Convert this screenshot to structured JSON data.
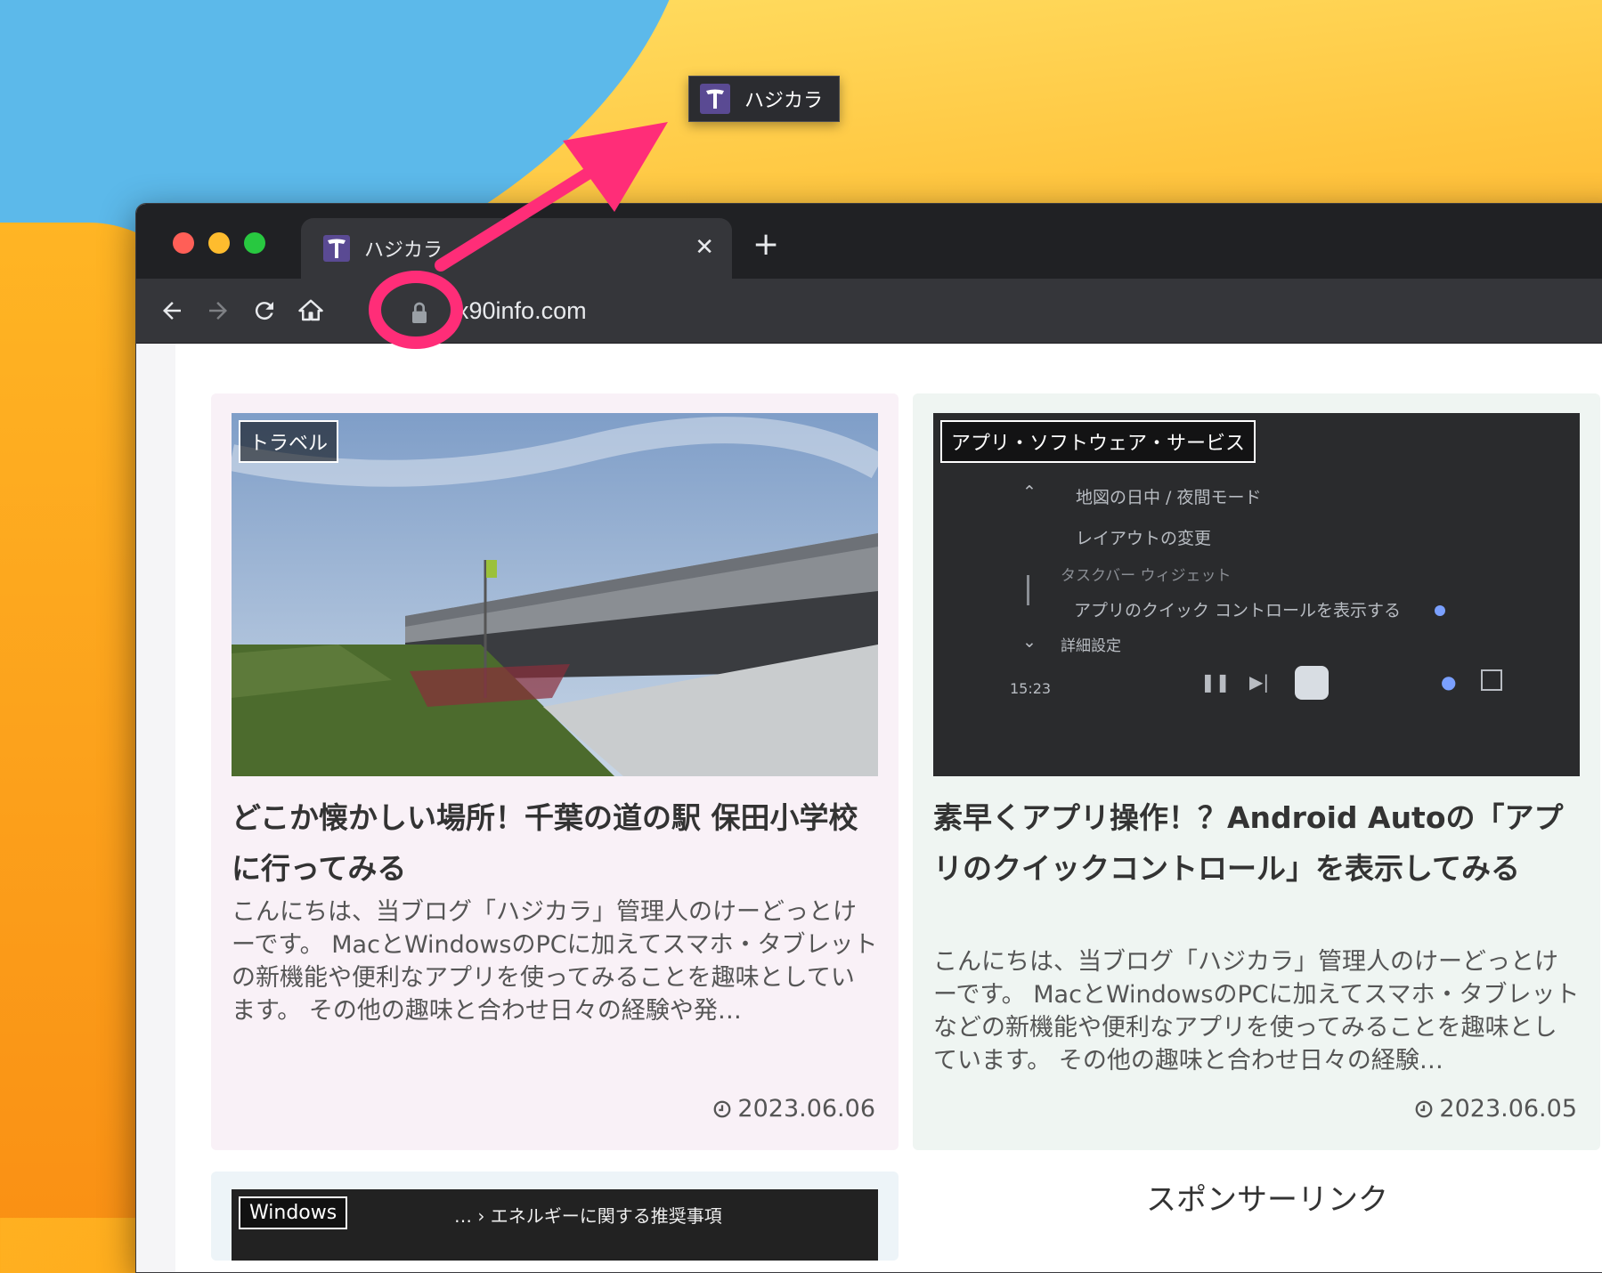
{
  "drag_preview": {
    "title": "ハジカラ"
  },
  "browser": {
    "tab": {
      "title": "ハジカラ",
      "close": "✕"
    },
    "new_tab": "+",
    "url": "x90info.com"
  },
  "cards": [
    {
      "category": "トラベル",
      "title": "どこか懐かしい場所！千葉の道の駅 保田小学校に行ってみる",
      "excerpt": "こんにちは、当ブログ「ハジカラ」管理人のけーどっとけーです。 MacとWindowsのPCに加えてスマホ・タブレットの新機能や便利なアプリを使ってみることを趣味としています。 その他の趣味と合わせ日々の経験や発…",
      "date": "2023.06.06"
    },
    {
      "category": "アプリ・ソフトウェア・サービス",
      "title": "素早くアプリ操作！？Android Autoの「アプリのクイックコントロール」を表示してみる",
      "excerpt": "こんにちは、当ブログ「ハジカラ」管理人のけーどっとけーです。 MacとWindowsのPCに加えてスマホ・タブレットなどの新機能や便利なアプリを使ってみることを趣味としています。 その他の趣味と合わせ日々の経験…",
      "date": "2023.06.05",
      "screen": {
        "item1": "地図の日中 / 夜間モード",
        "item2": "レイアウトの変更",
        "section": "タスクバー ウィジェット",
        "item3": "アプリのクイック コントロールを表示する",
        "item4": "詳細設定",
        "time": "15:23"
      }
    },
    {
      "category": "Windows",
      "text": "… › エネルギーに関する推奨事項"
    }
  ],
  "sponsor": "スポンサーリンク",
  "colors": {
    "highlight": "#ff2d78",
    "tab_bg": "#35363a",
    "strip_bg": "#202124"
  }
}
